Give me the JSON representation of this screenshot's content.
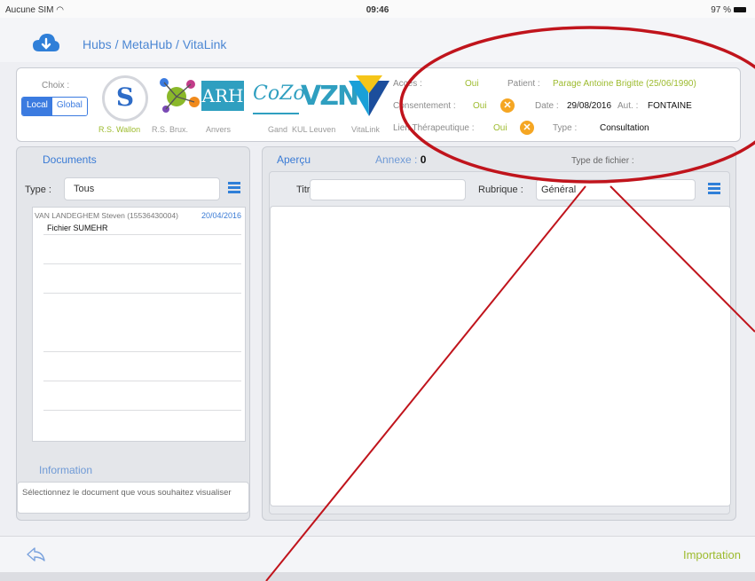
{
  "status_bar": {
    "carrier": "Aucune SIM",
    "time": "09:46",
    "battery": "97 %"
  },
  "header": {
    "breadcrumb": "Hubs / MetaHub / VitaLink"
  },
  "hubs": {
    "choix_label": "Choix :",
    "segment": {
      "local": "Local",
      "global": "Global",
      "selected": "Local"
    },
    "items": [
      {
        "logo_text": "S",
        "label": "R.S. Wallon",
        "selected": true
      },
      {
        "logo_text": "",
        "label": "R.S. Brux.",
        "selected": false
      },
      {
        "logo_text": "ARH",
        "label": "Anvers",
        "selected": false
      },
      {
        "logo_text": "CoZo",
        "label": "Gand",
        "selected": false
      },
      {
        "logo_text": "VZN",
        "label": "KUL Leuven",
        "selected": false
      },
      {
        "logo_text": "",
        "label": "VitaLink",
        "selected": false
      }
    ]
  },
  "patient_info": {
    "acces_label": "Accès :",
    "acces_value": "Oui",
    "patient_label": "Patient :",
    "patient_value": "Parage Antoine Brigitte (25/06/1990)",
    "consentement_label": "Consentement :",
    "consentement_value": "Oui",
    "date_label": "Date :",
    "date_value": "29/08/2016",
    "aut_label": "Aut. :",
    "aut_value": "FONTAINE",
    "lien_label": "Lien Thérapeutique :",
    "lien_value": "Oui",
    "type_label": "Type :",
    "type_value": "Consultation",
    "x_glyph": "✕"
  },
  "documents": {
    "title": "Documents",
    "type_label": "Type :",
    "type_value": "Tous",
    "entries": [
      {
        "author": "VAN LANDEGHEM Steven (15536430004)",
        "date": "20/04/2016",
        "file": "Fichier SUMEHR"
      }
    ]
  },
  "apercu": {
    "title": "Aperçu",
    "annexe_label": "Annexe :",
    "annexe_value": "0",
    "type_fichier_label": "Type de fichier :",
    "titre_label": "Titre :",
    "titre_value": "",
    "rubrique_label": "Rubrique :",
    "rubrique_value": "Général"
  },
  "information": {
    "title": "Information",
    "text": "Sélectionnez le document que vous souhaitez visualiser"
  },
  "bottom_bar": {
    "back_icon": "back-arrow-icon",
    "import_label": "Importation"
  },
  "colors": {
    "accent": "#3b7be0",
    "green": "#9dbb2e",
    "orange": "#f5a623",
    "annotation": "#c0141c"
  }
}
